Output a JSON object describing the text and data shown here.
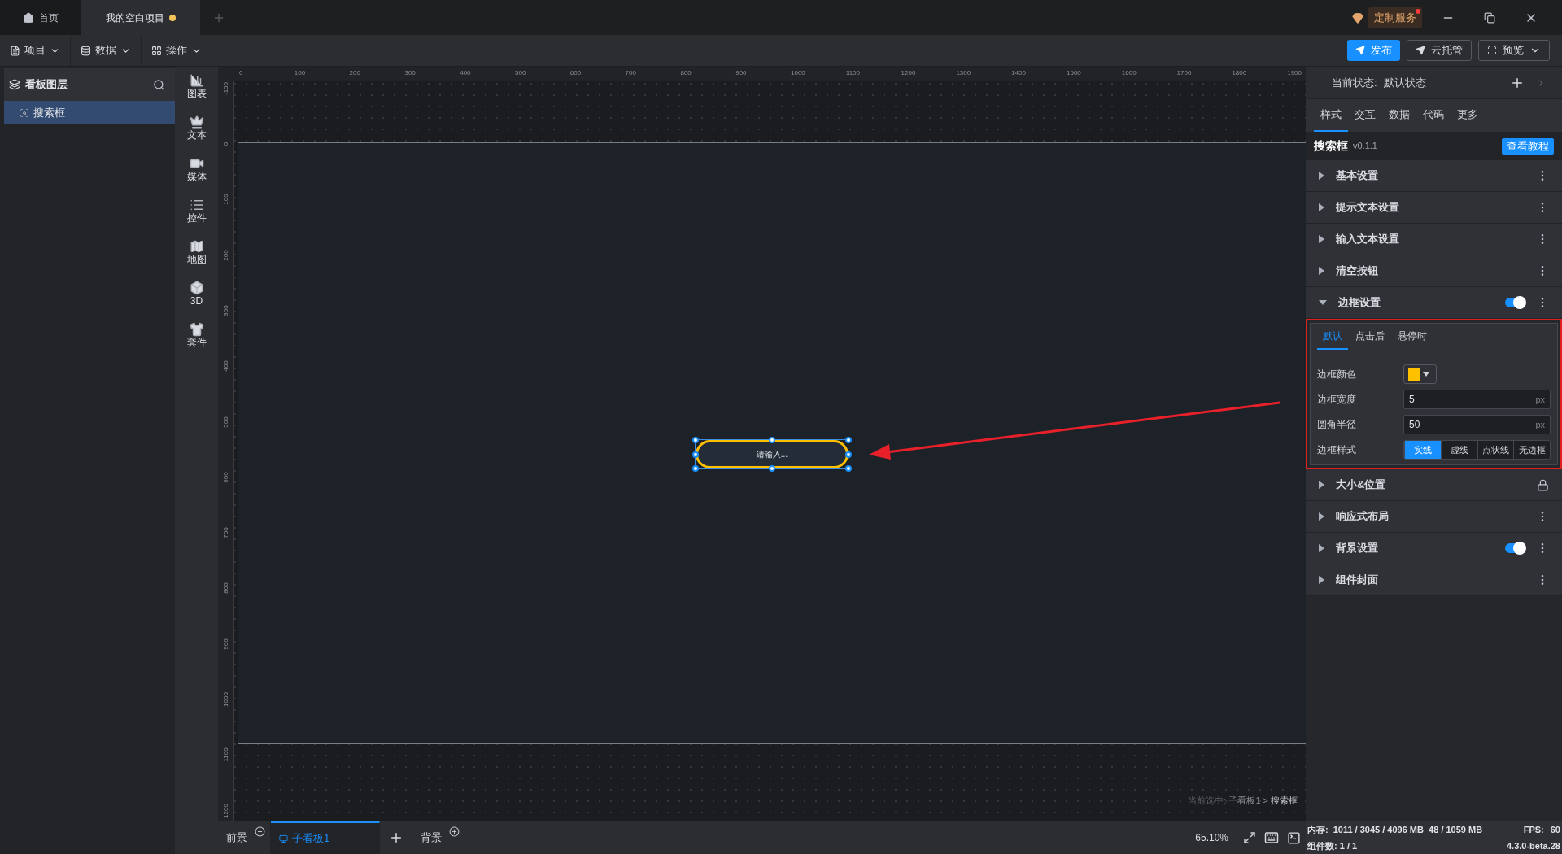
{
  "title_tabs": [
    {
      "label": "首页",
      "selected": false,
      "kind": "home"
    },
    {
      "label": "我的空白项目",
      "selected": true,
      "kind": "project",
      "unsaved": true
    }
  ],
  "custom_service": {
    "label": "定制服务",
    "badge": true
  },
  "toolbar_menus": [
    {
      "label": "项目",
      "kind": "file"
    },
    {
      "label": "数据",
      "kind": "data"
    },
    {
      "label": "操作",
      "kind": "grid"
    }
  ],
  "actions": [
    {
      "label": "发布",
      "kind": "send",
      "primary": true
    },
    {
      "label": "云托管",
      "kind": "send",
      "primary": false
    },
    {
      "label": "预览",
      "kind": "preview",
      "primary": false
    }
  ],
  "layers": {
    "title": "看板图层",
    "items": [
      {
        "label": "搜索框",
        "selected": true
      }
    ]
  },
  "component_categories": [
    {
      "label": "图表",
      "kind": "chart"
    },
    {
      "label": "文本",
      "kind": "text"
    },
    {
      "label": "媒体",
      "kind": "media"
    },
    {
      "label": "控件",
      "kind": "control"
    },
    {
      "label": "地图",
      "kind": "map"
    },
    {
      "label": "3D",
      "kind": "cube"
    },
    {
      "label": "套件",
      "kind": "kit"
    }
  ],
  "ruler": {
    "horizontal": [
      "0",
      "100",
      "200",
      "300",
      "400",
      "500",
      "600",
      "700",
      "800",
      "900",
      "1000",
      "1100",
      "1200",
      "1300",
      "1400",
      "1500",
      "1600",
      "1700",
      "1800",
      "1900"
    ],
    "vertical": [
      "-100",
      "0",
      "100",
      "200",
      "300",
      "400",
      "500",
      "600",
      "700",
      "800",
      "900",
      "1000",
      "1100",
      "1200"
    ]
  },
  "canvas": {
    "widget": {
      "placeholder": "请输入...",
      "selected": true
    },
    "breadcrumb": {
      "prefix": "当前选中:",
      "path": "子看板1 >",
      "current": "搜索框"
    }
  },
  "bottom_tabs": [
    {
      "label": "前景",
      "selected": false
    },
    {
      "label": "子看板1",
      "selected": true
    },
    {
      "label": "背景",
      "selected": false
    }
  ],
  "zoom": "65.10%",
  "inspector": {
    "state_label": "当前状态:",
    "state_value": "默认状态",
    "tabs": [
      {
        "label": "样式",
        "selected": true
      },
      {
        "label": "交互",
        "selected": false
      },
      {
        "label": "数据",
        "selected": false
      },
      {
        "label": "代码",
        "selected": false
      },
      {
        "label": "更多",
        "selected": false
      }
    ],
    "component": {
      "name": "搜索框",
      "version": "v0.1.1",
      "tutorial": "查看教程"
    },
    "sections": [
      {
        "title": "基本设置",
        "expanded": false,
        "kind": "menu"
      },
      {
        "title": "提示文本设置",
        "expanded": false,
        "kind": "menu"
      },
      {
        "title": "输入文本设置",
        "expanded": false,
        "kind": "menu"
      },
      {
        "title": "清空按钮",
        "expanded": false,
        "kind": "menu"
      },
      {
        "title": "边框设置",
        "expanded": true,
        "kind": "menu",
        "toggle": {
          "on": true
        },
        "highlighted": true,
        "state_tabs": [
          {
            "label": "默认",
            "selected": true
          },
          {
            "label": "点击后",
            "selected": false
          },
          {
            "label": "悬停时",
            "selected": false
          }
        ],
        "fields": [
          {
            "kind": "color",
            "label": "边框颜色",
            "color": "#ffc000"
          },
          {
            "kind": "number",
            "label": "边框宽度",
            "value": "5",
            "unit": "px"
          },
          {
            "kind": "number",
            "label": "圆角半径",
            "value": "50",
            "unit": "px"
          },
          {
            "kind": "segmented",
            "label": "边框样式",
            "options": [
              {
                "label": "实线",
                "selected": true
              },
              {
                "label": "虚线",
                "selected": false
              },
              {
                "label": "点状线",
                "selected": false
              },
              {
                "label": "无边框",
                "selected": false
              }
            ]
          }
        ]
      },
      {
        "title": "大小&位置",
        "expanded": false,
        "kind": "lock"
      },
      {
        "title": "响应式布局",
        "expanded": false,
        "kind": "menu"
      },
      {
        "title": "背景设置",
        "expanded": false,
        "kind": "menu",
        "toggle": {
          "on": true
        }
      },
      {
        "title": "组件封面",
        "expanded": false,
        "kind": "menu"
      }
    ]
  },
  "footer": {
    "memory_label": "内存:",
    "memory": "1011 / 3045 / 4096 MB  48 / 1059 MB",
    "fps_label": "FPS:",
    "fps": "60",
    "count": "组件数: 1 / 1",
    "version": "4.3.0-beta.28"
  }
}
